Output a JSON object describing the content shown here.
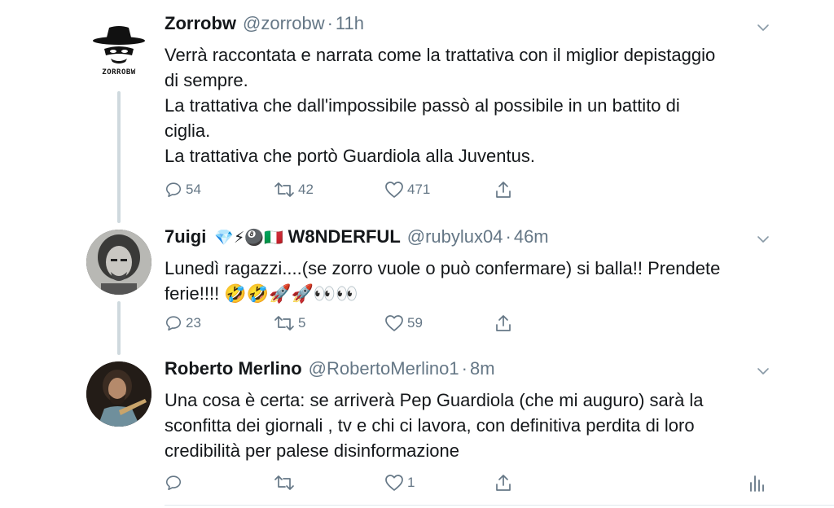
{
  "tweets": [
    {
      "name": "Zorrobw",
      "handle": "@zorrobw",
      "time": "11h",
      "avatar_label": "ZORROBW",
      "lines": [
        "Verrà raccontata e narrata come la trattativa con il miglior depistaggio",
        "di sempre.",
        "La trattativa che dall'impossibile passò al possibile in un battito di",
        "ciglia.",
        "La trattativa che portò Guardiola alla Juventus."
      ],
      "replies": "54",
      "retweets": "42",
      "likes": "471"
    },
    {
      "name": "7uigi",
      "name_emojis": "💎⚡🎱🇮🇹",
      "name_suffix": "W8NDERFUL",
      "handle": "@rubylux04",
      "time": "46m",
      "lines": [
        "Lunedì ragazzi....(se zorro vuole o può confermare) si balla!! Prendete",
        "ferie!!!! 🤣🤣🚀🚀👀👀"
      ],
      "replies": "23",
      "retweets": "5",
      "likes": "59"
    },
    {
      "name": "Roberto Merlino",
      "handle": "@RobertoMerlino1",
      "time": "8m",
      "lines": [
        "Una cosa è certa: se arriverà Pep Guardiola (che mi auguro) sarà la",
        "sconfitta dei giornali , tv e chi ci lavora, con definitiva perdita di loro",
        "credibilità per palese disinformazione"
      ],
      "replies": "",
      "retweets": "",
      "likes": "1"
    }
  ],
  "separator": "·",
  "icons": {
    "reply": "reply-icon",
    "retweet": "retweet-icon",
    "like": "heart-icon",
    "share": "share-icon",
    "analytics": "analytics-icon",
    "menu": "chevron-down-icon"
  },
  "colors": {
    "text": "#14171a",
    "secondary": "#657786",
    "thread_line": "#cfd9de"
  }
}
